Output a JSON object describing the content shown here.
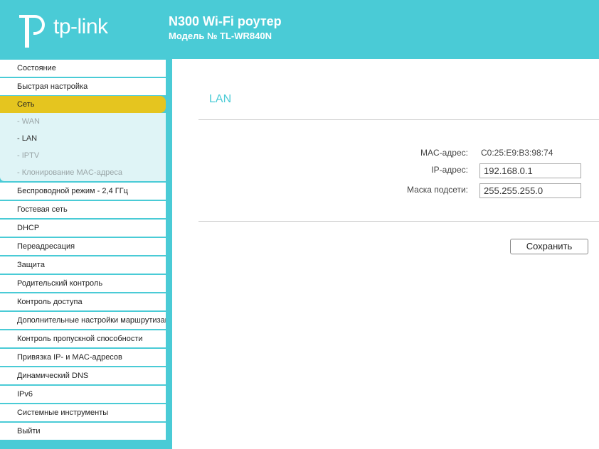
{
  "brand": {
    "logo_text": "tp-link",
    "product_title": "N300 Wi-Fi роутер",
    "model_line": "Модель № TL-WR840N",
    "accent_color": "#4acbd6",
    "active_color": "#e5c51f"
  },
  "sidebar": {
    "items": [
      {
        "label": "Состояние"
      },
      {
        "label": "Быстрая настройка"
      },
      {
        "label": "Сеть",
        "active": true
      },
      {
        "label": "Беспроводной режим - 2,4 ГГц"
      },
      {
        "label": "Гостевая сеть"
      },
      {
        "label": "DHCP"
      },
      {
        "label": "Переадресация"
      },
      {
        "label": "Защита"
      },
      {
        "label": "Родительский контроль"
      },
      {
        "label": "Контроль доступа"
      },
      {
        "label": "Дополнительные настройки маршрутизации"
      },
      {
        "label": "Контроль пропускной способности"
      },
      {
        "label": "Привязка IP- и MAC-адресов"
      },
      {
        "label": "Динамический DNS"
      },
      {
        "label": "IPv6"
      },
      {
        "label": "Системные инструменты"
      },
      {
        "label": "Выйти"
      }
    ],
    "network_submenu": [
      {
        "label": "- WAN"
      },
      {
        "label": "- LAN",
        "current": true
      },
      {
        "label": "- IPTV"
      },
      {
        "label": "- Клонирование MAC-адреса"
      }
    ]
  },
  "main": {
    "section_title": "LAN",
    "mac_label": "MAC-адрес:",
    "mac_value": "C0:25:E9:B3:98:74",
    "ip_label": "IP-адрес:",
    "ip_value": "192.168.0.1",
    "mask_label": "Маска подсети:",
    "mask_value": "255.255.255.0",
    "save_label": "Сохранить"
  }
}
